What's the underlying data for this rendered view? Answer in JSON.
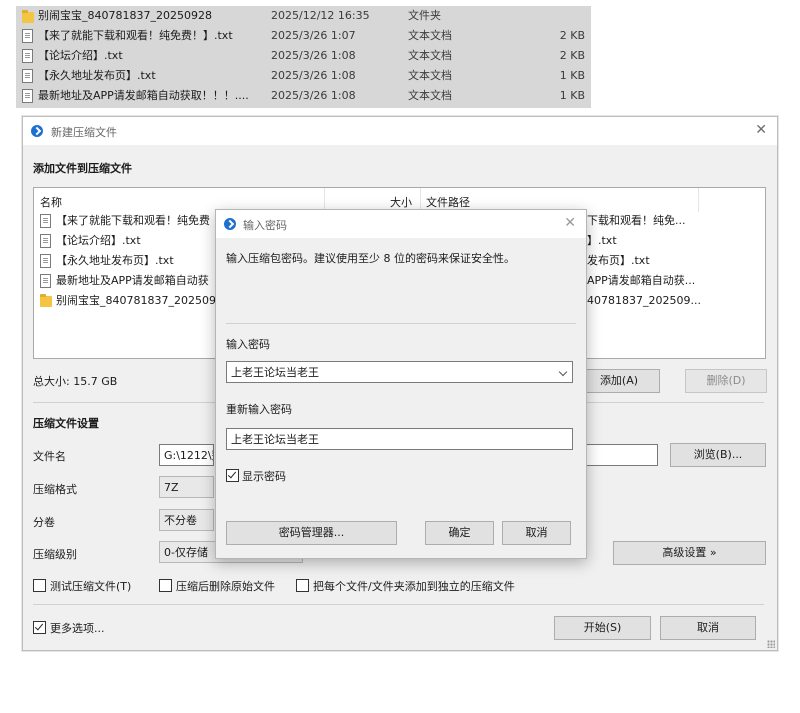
{
  "file_list": [
    {
      "icon": "folder-icon",
      "name": "别闹宝宝_840781837_20250928",
      "date": "2025/12/12 16:35",
      "type": "文件夹",
      "size": ""
    },
    {
      "icon": "text-file-icon",
      "name": "【来了就能下载和观看！纯免费！】.txt",
      "date": "2025/3/26 1:07",
      "type": "文本文档",
      "size": "2 KB"
    },
    {
      "icon": "text-file-icon",
      "name": "【论坛介绍】.txt",
      "date": "2025/3/26 1:08",
      "type": "文本文档",
      "size": "2 KB"
    },
    {
      "icon": "text-file-icon",
      "name": "【永久地址发布页】.txt",
      "date": "2025/3/26 1:08",
      "type": "文本文档",
      "size": "1 KB"
    },
    {
      "icon": "text-file-icon",
      "name": "最新地址及APP请发邮箱自动获取！！！....",
      "date": "2025/3/26 1:08",
      "type": "文本文档",
      "size": "1 KB"
    }
  ],
  "main_dialog": {
    "title": "新建压缩文件",
    "add_section_title": "添加文件到压缩文件",
    "columns": {
      "name": "名称",
      "size": "大小",
      "path": "文件路径"
    },
    "items": [
      {
        "icon": "text-file-icon",
        "name": "【来了就能下载和观看！纯免费",
        "path": "下载和观看！纯免..."
      },
      {
        "icon": "text-file-icon",
        "name": "【论坛介绍】.txt",
        "path": "】.txt"
      },
      {
        "icon": "text-file-icon",
        "name": "【永久地址发布页】.txt",
        "path": "发布页】.txt"
      },
      {
        "icon": "text-file-icon",
        "name": "最新地址及APP请发邮箱自动获",
        "path": "APP请发邮箱自动获..."
      },
      {
        "icon": "folder-icon",
        "name": "别闹宝宝_840781837_2025092",
        "path": "40781837_202509..."
      }
    ],
    "total_size": "总大小: 15.7 GB",
    "add_button": "添加(A)",
    "delete_button": "删除(D)",
    "settings_title": "压缩文件设置",
    "filename_label": "文件名",
    "filename_value": "G:\\1212\\别",
    "browse_button": "浏览(B)...",
    "format_label": "压缩格式",
    "format_value": "7Z",
    "split_label": "分卷",
    "split_value": "不分卷",
    "level_label": "压缩级别",
    "level_value": "0-仅存储",
    "advanced_button": "高级设置 »",
    "test_checkbox": "测试压缩文件(T)",
    "delete_after_checkbox": "压缩后删除原始文件",
    "separate_checkbox": "把每个文件/文件夹添加到独立的压缩文件",
    "more_options_checkbox": "更多选项...",
    "start_button": "开始(S)",
    "cancel_button": "取消"
  },
  "password_dialog": {
    "title": "输入密码",
    "hint": "输入压缩包密码。建议使用至少 8 位的密码来保证安全性。",
    "password_label": "输入密码",
    "password_value": "上老王论坛当老王",
    "repeat_label": "重新输入密码",
    "repeat_value": "上老王论坛当老王",
    "show_password": "显示密码",
    "manager_button": "密码管理器...",
    "ok_button": "确定",
    "cancel_button": "取消"
  }
}
